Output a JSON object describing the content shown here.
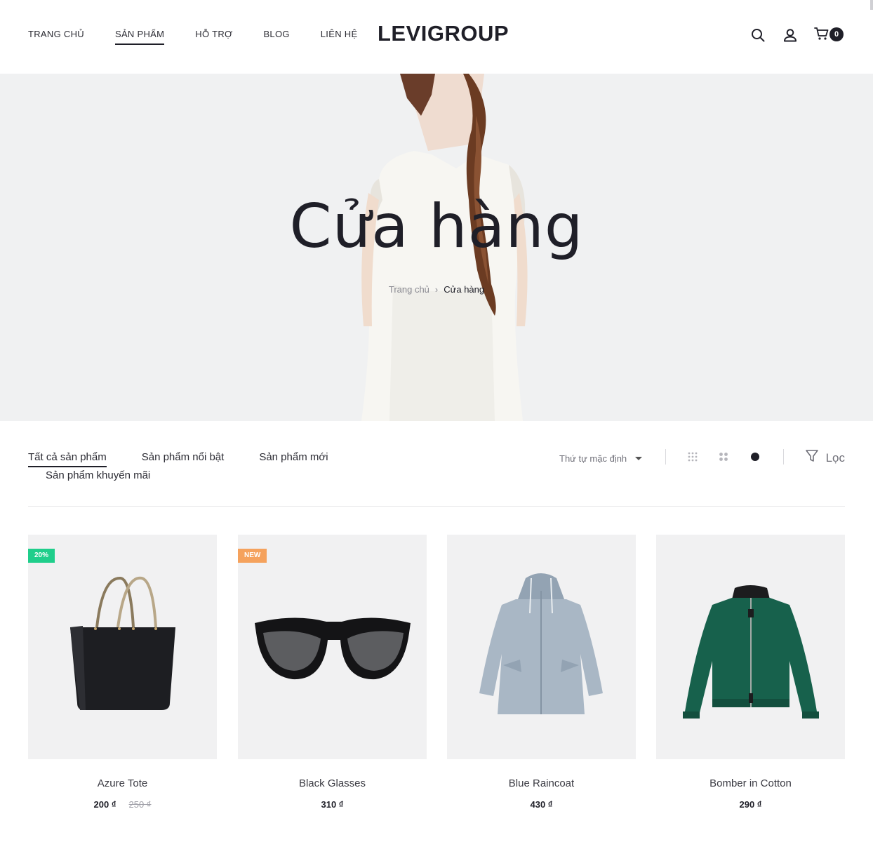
{
  "header": {
    "nav": [
      "TRANG CHỦ",
      "SẢN PHẨM",
      "HỖ TRỢ",
      "BLOG",
      "LIÊN HỆ"
    ],
    "active_nav": "SẢN PHẨM",
    "logo": "LEVIGROUP",
    "cart_count": "0",
    "icons": [
      "search-icon",
      "user-icon",
      "cart-icon"
    ]
  },
  "hero": {
    "title": "Cửa hàng",
    "breadcrumb": {
      "home": "Trang chủ",
      "separator": "›",
      "current": "Cửa hàng"
    }
  },
  "toolbar": {
    "tabs": [
      "Tất cả sản phẩm",
      "Sản phẩm nổi bật",
      "Sản phẩm mới",
      "Sản phẩm khuyến mãi"
    ],
    "active_tab": "Tất cả sản phẩm",
    "sort_label": "Thứ tự mặc định",
    "view_icons": [
      "grid-small-icon",
      "grid-medium-icon",
      "grid-large-icon"
    ],
    "active_view": "grid-large-icon",
    "filter_label": "Lọc"
  },
  "products": [
    {
      "name": "Azure Tote",
      "price": "200 ₫",
      "old_price": "250 ₫",
      "badge": "20%",
      "badge_color": "#1fce8b"
    },
    {
      "name": "Black Glasses",
      "price": "310 ₫",
      "old_price": "",
      "badge": "NEW",
      "badge_color": "#f5a25d"
    },
    {
      "name": "Blue Raincoat",
      "price": "430 ₫",
      "old_price": "",
      "badge": "",
      "badge_color": ""
    },
    {
      "name": "Bomber in Cotton",
      "price": "290 ₫",
      "old_price": "",
      "badge": "",
      "badge_color": ""
    }
  ],
  "colors": {
    "text": "#1f1f28",
    "hero_bg": "#f0f1f2",
    "card_bg": "#f1f1f2",
    "sale_badge": "#1fce8b",
    "new_badge": "#f5a25d"
  }
}
